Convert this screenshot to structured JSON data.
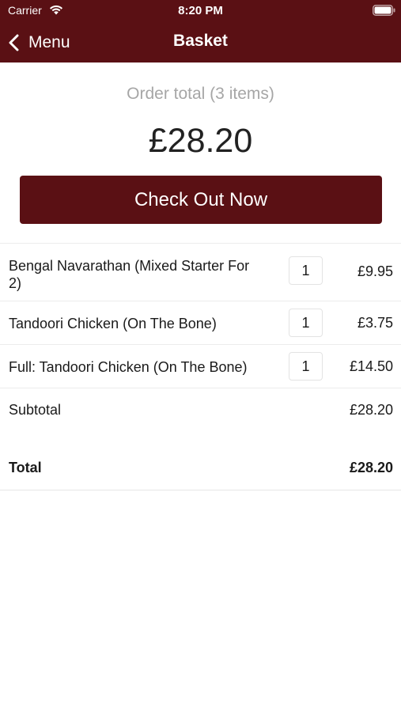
{
  "status_bar": {
    "carrier": "Carrier",
    "time": "8:20 PM"
  },
  "nav": {
    "back_label": "Menu",
    "title": "Basket"
  },
  "summary": {
    "label": "Order total (3 items)",
    "total": "£28.20"
  },
  "checkout": {
    "label": "Check Out Now"
  },
  "items": [
    {
      "name": "Bengal Navarathan (Mixed Starter For 2)",
      "qty": "1",
      "price": "£9.95"
    },
    {
      "name": "Tandoori Chicken (On The Bone)",
      "qty": "1",
      "price": "£3.75"
    },
    {
      "name": "Full: Tandoori Chicken (On The Bone)",
      "qty": "1",
      "price": "£14.50"
    }
  ],
  "totals": {
    "subtotal_label": "Subtotal",
    "subtotal_value": "£28.20",
    "total_label": "Total",
    "total_value": "£28.20"
  },
  "colors": {
    "brand": "#5a1014",
    "muted_text": "#a6a6a6",
    "divider": "#ececec"
  },
  "icons": {
    "back": "chevron-left-icon",
    "wifi": "wifi-icon",
    "battery": "battery-icon"
  }
}
